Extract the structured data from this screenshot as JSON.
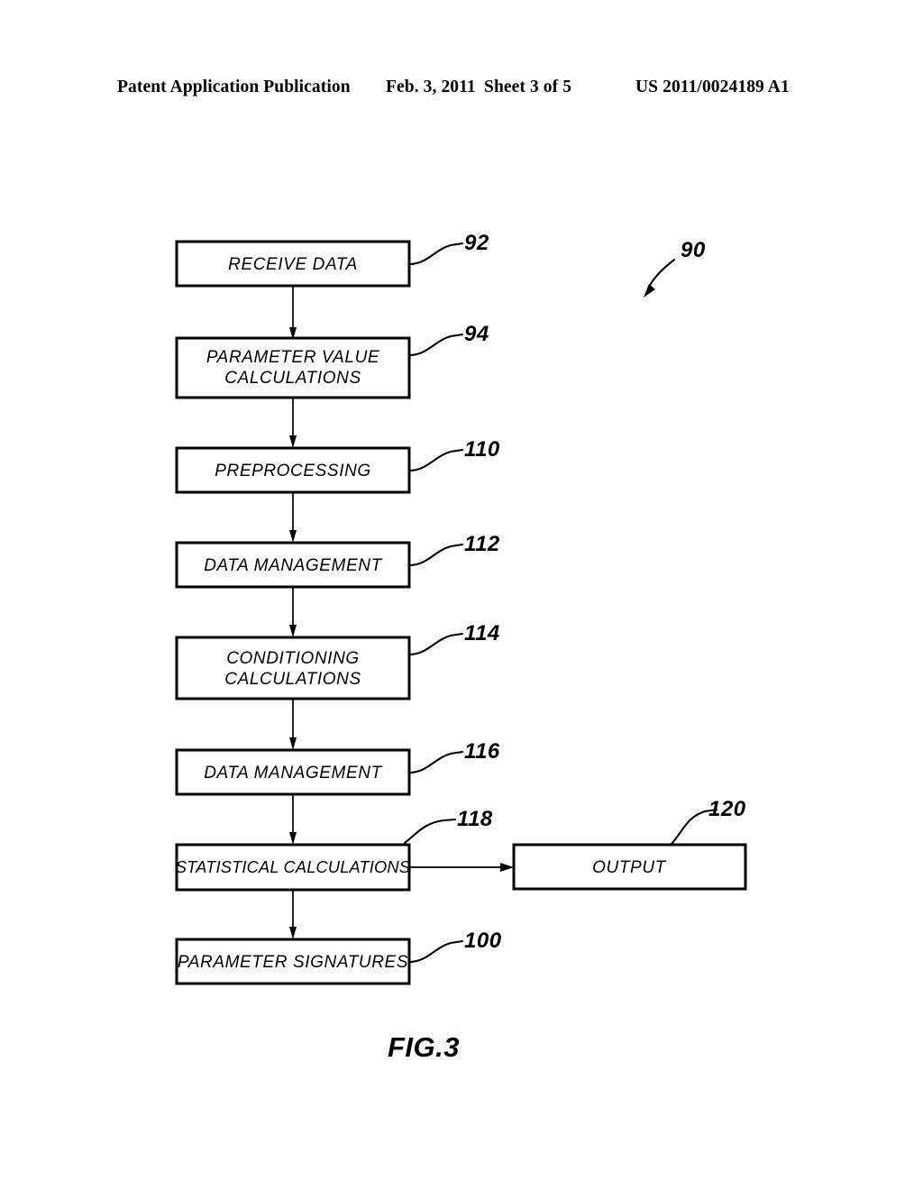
{
  "header": {
    "title": "Patent Application Publication",
    "date": "Feb. 3, 2011",
    "sheet": "Sheet 3 of 5",
    "publication_number": "US 2011/0024189 A1"
  },
  "figure": {
    "caption": "FIG.3",
    "diagram_reference": "90",
    "nodes": [
      {
        "id": "receive-data",
        "ref": "92",
        "lines": [
          "RECEIVE  DATA"
        ]
      },
      {
        "id": "parameter-value-calc",
        "ref": "94",
        "lines": [
          "PARAMETER  VALUE",
          "CALCULATIONS"
        ]
      },
      {
        "id": "preprocessing",
        "ref": "110",
        "lines": [
          "PREPROCESSING"
        ]
      },
      {
        "id": "data-management-1",
        "ref": "112",
        "lines": [
          "DATA  MANAGEMENT"
        ]
      },
      {
        "id": "conditioning-calc",
        "ref": "114",
        "lines": [
          "CONDITIONING",
          "CALCULATIONS"
        ]
      },
      {
        "id": "data-management-2",
        "ref": "116",
        "lines": [
          "DATA  MANAGEMENT"
        ]
      },
      {
        "id": "statistical-calc",
        "ref": "118",
        "lines": [
          "STATISTICAL  CALCULATIONS"
        ]
      },
      {
        "id": "parameter-signatures",
        "ref": "100",
        "lines": [
          "PARAMETER  SIGNATURES"
        ]
      },
      {
        "id": "output",
        "ref": "120",
        "lines": [
          "OUTPUT"
        ]
      }
    ]
  }
}
